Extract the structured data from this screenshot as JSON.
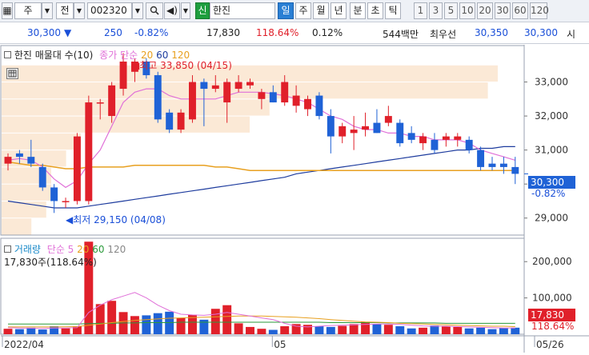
{
  "toolbar": {
    "market_label": "주",
    "type_label": "전",
    "code": "002320",
    "badge": "신",
    "stock_name": "한진",
    "periods": [
      "일",
      "주",
      "월",
      "년",
      "분",
      "초",
      "틱"
    ],
    "active_period": "일",
    "intervals": [
      "1",
      "3",
      "5",
      "10",
      "20",
      "30",
      "60",
      "120"
    ]
  },
  "quote": {
    "price": "30,300",
    "change": "250",
    "change_pct": "-0.82%",
    "volume": "17,830",
    "volume_ratio": "118.64%",
    "turnover_pct": "0.12%",
    "amount": "544백만",
    "best_label": "최우선",
    "ask": "30,350",
    "bid": "30,300",
    "extra_label": "시"
  },
  "colors": {
    "up": "#e0202a",
    "down": "#1f62d6",
    "ma5": "#e070d8",
    "ma20": "#e8a020",
    "ma60": "#1e3c9e",
    "ma120": "#999999",
    "profile": "#fbe9d6"
  },
  "price_panel": {
    "legend_title": "한진 매물대 수(10)",
    "ma_label": "종가 단순",
    "ma_periods": [
      "20",
      "60",
      "120"
    ],
    "high_note": "최고 33,850 (04/15)",
    "low_note": "최저 29,150 (04/08)",
    "current_price": "30,300",
    "current_change": "-0.82%"
  },
  "volume_panel": {
    "legend_title": "거래량",
    "ma_label": "단순 5",
    "ma_periods": [
      "20",
      "60",
      "120"
    ],
    "current_note": "17,830주(118.64%)",
    "current_volume": "17,830",
    "current_ratio": "118.64%"
  },
  "chart_data": {
    "type": "candlestick",
    "price_axis": {
      "min": 28500,
      "max": 34000,
      "ticks": [
        29000,
        30000,
        31000,
        32000,
        33000
      ]
    },
    "volume_axis": {
      "min": 0,
      "max": 260000,
      "ticks": [
        100000,
        200000
      ],
      "tick_labels": [
        "100,000",
        "200,000"
      ]
    },
    "x_labels": [
      {
        "index": 0,
        "text": "2022/04"
      },
      {
        "index": 23,
        "text": "05"
      },
      {
        "index": 45,
        "text": "05/26"
      }
    ],
    "candles": [
      {
        "o": 30600,
        "h": 30900,
        "l": 30400,
        "c": 30800
      },
      {
        "o": 30900,
        "h": 31000,
        "l": 30600,
        "c": 30800
      },
      {
        "o": 30800,
        "h": 31300,
        "l": 30500,
        "c": 30600
      },
      {
        "o": 30500,
        "h": 30600,
        "l": 29800,
        "c": 29900
      },
      {
        "o": 29900,
        "h": 30000,
        "l": 29150,
        "c": 29500
      },
      {
        "o": 29500,
        "h": 29600,
        "l": 29300,
        "c": 29500
      },
      {
        "o": 29500,
        "h": 31500,
        "l": 29400,
        "c": 31400
      },
      {
        "o": 29500,
        "h": 32600,
        "l": 29400,
        "c": 32400
      },
      {
        "o": 32400,
        "h": 32500,
        "l": 31900,
        "c": 32400
      },
      {
        "o": 32000,
        "h": 33000,
        "l": 31800,
        "c": 32900
      },
      {
        "o": 32800,
        "h": 33850,
        "l": 32600,
        "c": 33600
      },
      {
        "o": 33300,
        "h": 33700,
        "l": 33000,
        "c": 33600
      },
      {
        "o": 33600,
        "h": 33700,
        "l": 33100,
        "c": 33200
      },
      {
        "o": 33200,
        "h": 33300,
        "l": 31800,
        "c": 31900
      },
      {
        "o": 32100,
        "h": 32200,
        "l": 31500,
        "c": 31600
      },
      {
        "o": 31600,
        "h": 32200,
        "l": 31500,
        "c": 32100
      },
      {
        "o": 31900,
        "h": 33200,
        "l": 31800,
        "c": 33000
      },
      {
        "o": 33000,
        "h": 33100,
        "l": 31700,
        "c": 32800
      },
      {
        "o": 32800,
        "h": 33200,
        "l": 32700,
        "c": 32900
      },
      {
        "o": 32400,
        "h": 33100,
        "l": 31800,
        "c": 33000
      },
      {
        "o": 32800,
        "h": 33200,
        "l": 32700,
        "c": 33000
      },
      {
        "o": 32900,
        "h": 33100,
        "l": 32800,
        "c": 33000
      },
      {
        "o": 32500,
        "h": 32800,
        "l": 32200,
        "c": 32700
      },
      {
        "o": 32700,
        "h": 32900,
        "l": 32400,
        "c": 32400
      },
      {
        "o": 32400,
        "h": 33200,
        "l": 32300,
        "c": 33000
      },
      {
        "o": 32300,
        "h": 32900,
        "l": 32100,
        "c": 32600
      },
      {
        "o": 32200,
        "h": 32600,
        "l": 32000,
        "c": 32500
      },
      {
        "o": 32600,
        "h": 32700,
        "l": 31900,
        "c": 32000
      },
      {
        "o": 32000,
        "h": 32200,
        "l": 30900,
        "c": 31400
      },
      {
        "o": 31400,
        "h": 31800,
        "l": 31200,
        "c": 31700
      },
      {
        "o": 31500,
        "h": 32000,
        "l": 31000,
        "c": 31600
      },
      {
        "o": 31600,
        "h": 32100,
        "l": 31400,
        "c": 31700
      },
      {
        "o": 31800,
        "h": 32200,
        "l": 31500,
        "c": 31500
      },
      {
        "o": 31800,
        "h": 32300,
        "l": 31700,
        "c": 32000
      },
      {
        "o": 31800,
        "h": 31900,
        "l": 31100,
        "c": 31200
      },
      {
        "o": 31500,
        "h": 31700,
        "l": 31200,
        "c": 31300
      },
      {
        "o": 31200,
        "h": 31500,
        "l": 31000,
        "c": 31400
      },
      {
        "o": 31300,
        "h": 31500,
        "l": 30900,
        "c": 31000
      },
      {
        "o": 31300,
        "h": 31500,
        "l": 31100,
        "c": 31400
      },
      {
        "o": 31300,
        "h": 31500,
        "l": 31100,
        "c": 31400
      },
      {
        "o": 31300,
        "h": 31400,
        "l": 30900,
        "c": 31000
      },
      {
        "o": 31000,
        "h": 31100,
        "l": 30400,
        "c": 30500
      },
      {
        "o": 30600,
        "h": 30800,
        "l": 30400,
        "c": 30500
      },
      {
        "o": 30600,
        "h": 30800,
        "l": 30300,
        "c": 30500
      },
      {
        "o": 30500,
        "h": 30800,
        "l": 30000,
        "c": 30300
      }
    ],
    "volumes": [
      15000,
      14000,
      18000,
      13000,
      22000,
      16000,
      22000,
      255000,
      83000,
      92000,
      61000,
      50000,
      52000,
      58000,
      62000,
      45000,
      54000,
      40000,
      70000,
      80000,
      30000,
      20000,
      15000,
      12000,
      22000,
      28000,
      26000,
      22000,
      20000,
      23000,
      28000,
      34000,
      28000,
      26000,
      22000,
      16000,
      18000,
      24000,
      22000,
      20000,
      16000,
      18000,
      14000,
      17000,
      18000
    ],
    "ma5": [
      30700,
      30750,
      30700,
      30500,
      30150,
      29900,
      30100,
      30600,
      31000,
      31700,
      32400,
      32700,
      32800,
      32800,
      32600,
      32500,
      32500,
      32500,
      32500,
      32600,
      32700,
      32700,
      32700,
      32650,
      32600,
      32500,
      32400,
      32200,
      32000,
      31900,
      31700,
      31600,
      31600,
      31500,
      31500,
      31400,
      31400,
      31300,
      31300,
      31300,
      31200,
      31000,
      30900,
      30800,
      30700
    ],
    "ma20": [
      30650,
      30600,
      30550,
      30550,
      30500,
      30450,
      30450,
      30500,
      30500,
      30500,
      30500,
      30550,
      30550,
      30550,
      30550,
      30550,
      30550,
      30550,
      30500,
      30500,
      30450,
      30400,
      30400,
      30400,
      30400,
      30400,
      30400,
      30400,
      30400,
      30400,
      30400,
      30400,
      30400,
      30400,
      30400,
      30400,
      30400,
      30400,
      30400,
      30400,
      30400,
      30400,
      30400,
      30400,
      30400
    ],
    "ma60": [
      29500,
      29450,
      29400,
      29350,
      29300,
      29300,
      29300,
      29350,
      29400,
      29450,
      29500,
      29550,
      29600,
      29650,
      29700,
      29750,
      29800,
      29850,
      29900,
      29950,
      30000,
      30050,
      30100,
      30150,
      30200,
      30300,
      30350,
      30400,
      30450,
      30500,
      30550,
      30600,
      30650,
      30700,
      30750,
      30800,
      30850,
      30900,
      30950,
      31000,
      31000,
      31050,
      31050,
      31100,
      31100
    ],
    "vol_ma5": [
      18000,
      17000,
      16500,
      16000,
      17000,
      17000,
      18000,
      60000,
      80000,
      95000,
      105000,
      115000,
      100000,
      80000,
      65000,
      55000,
      53000,
      52000,
      55000,
      60000,
      55000,
      50000,
      45000,
      40000,
      30000,
      22000,
      20000,
      22000,
      24000,
      25000,
      26000,
      27000,
      28000,
      28000,
      27000,
      25000,
      23000,
      22000,
      22000,
      21000,
      20000,
      19000,
      18000,
      17000,
      17000
    ],
    "vol_ma20": [
      20000,
      20000,
      20000,
      20000,
      20000,
      20500,
      21000,
      25000,
      28000,
      32000,
      35000,
      38000,
      40000,
      42000,
      44000,
      45000,
      46000,
      47000,
      48000,
      49000,
      50000,
      50000,
      50000,
      49000,
      48000,
      47000,
      45000,
      43000,
      40000,
      38000,
      36000,
      34000,
      33000,
      32000,
      30000,
      29000,
      28000,
      27000,
      26000,
      25000,
      24000,
      23000,
      22000,
      22000,
      21000
    ],
    "vol_ma60": [
      28000,
      28000,
      28000,
      28000,
      28000,
      28000,
      28000,
      29000,
      30000,
      30000,
      31000,
      31000,
      32000,
      32000,
      32000,
      33000,
      33000,
      33000,
      33000,
      33000,
      33000,
      33000,
      33000,
      33000,
      33000,
      33000,
      33000,
      33000,
      32000,
      32000,
      32000,
      32000,
      32000,
      31000,
      31000,
      31000,
      31000,
      31000,
      30000,
      30000,
      30000,
      30000,
      30000,
      30000,
      30000
    ],
    "volume_profile": [
      {
        "price": 33250,
        "volume": 100
      },
      {
        "price": 32750,
        "volume": 98
      },
      {
        "price": 32250,
        "volume": 54
      },
      {
        "price": 31750,
        "volume": 50
      },
      {
        "price": 31250,
        "volume": 16
      },
      {
        "price": 30750,
        "volume": 13
      },
      {
        "price": 30250,
        "volume": 10
      },
      {
        "price": 29750,
        "volume": 10
      },
      {
        "price": 29250,
        "volume": 9
      },
      {
        "price": 28750,
        "volume": 6
      }
    ]
  }
}
